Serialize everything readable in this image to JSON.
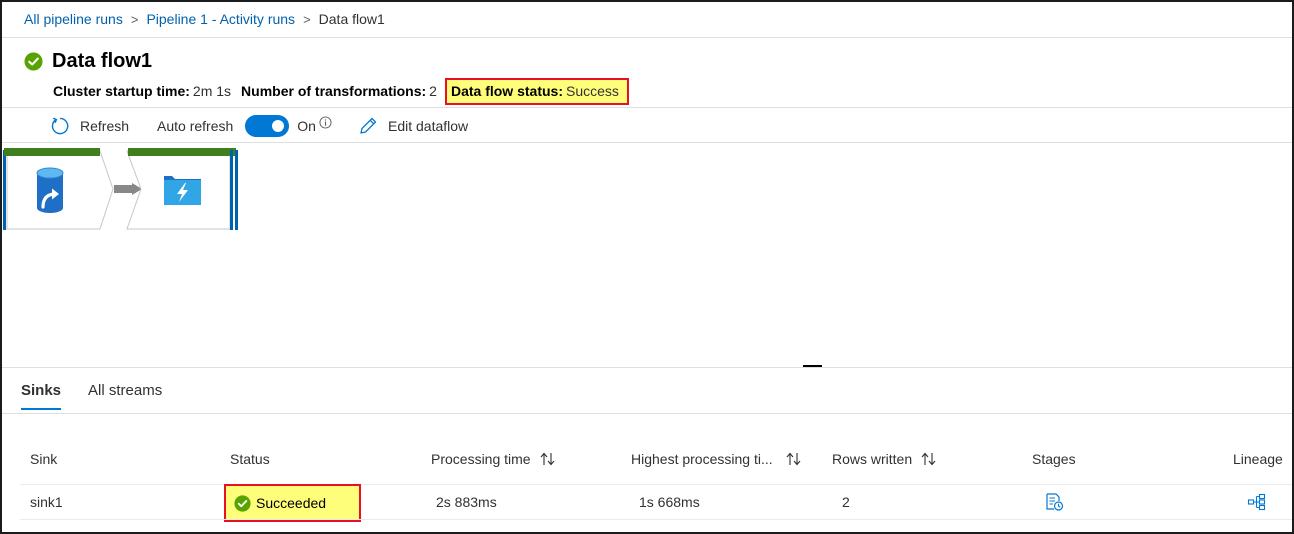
{
  "breadcrumb": {
    "items": [
      "All pipeline runs",
      "Pipeline 1 - Activity runs"
    ],
    "current": "Data flow1",
    "separator": ">"
  },
  "header": {
    "title": "Data flow1",
    "cluster_startup_label": "Cluster startup time:",
    "cluster_startup_value": "2m 1s",
    "transformations_label": "Number of transformations:",
    "transformations_value": "2",
    "status_label": "Data flow status:",
    "status_value": "Success"
  },
  "toolbar": {
    "refresh_label": "Refresh",
    "auto_refresh_label": "Auto refresh",
    "toggle_state": "On",
    "edit_label": "Edit dataflow"
  },
  "graph": {
    "nodes": [
      {
        "name": "source",
        "icon": "source-database-icon"
      },
      {
        "name": "sink",
        "icon": "sink-folder-icon"
      }
    ]
  },
  "tabs": [
    {
      "label": "Sinks",
      "active": true
    },
    {
      "label": "All streams",
      "active": false
    }
  ],
  "table": {
    "columns": [
      "Sink",
      "Status",
      "Processing time",
      "Highest processing ti...",
      "Rows written",
      "Stages",
      "Lineage"
    ],
    "rows": [
      {
        "sink": "sink1",
        "status": "Succeeded",
        "processing_time": "2s 883ms",
        "highest_processing_time": "1s 668ms",
        "rows_written": "2"
      }
    ]
  },
  "colors": {
    "accent": "#0078d4",
    "link": "#0062ad",
    "success": "#57a300",
    "highlight": "#fffe7a",
    "highlight_border": "#e81123",
    "node_top_bar": "#3f7f1e"
  }
}
